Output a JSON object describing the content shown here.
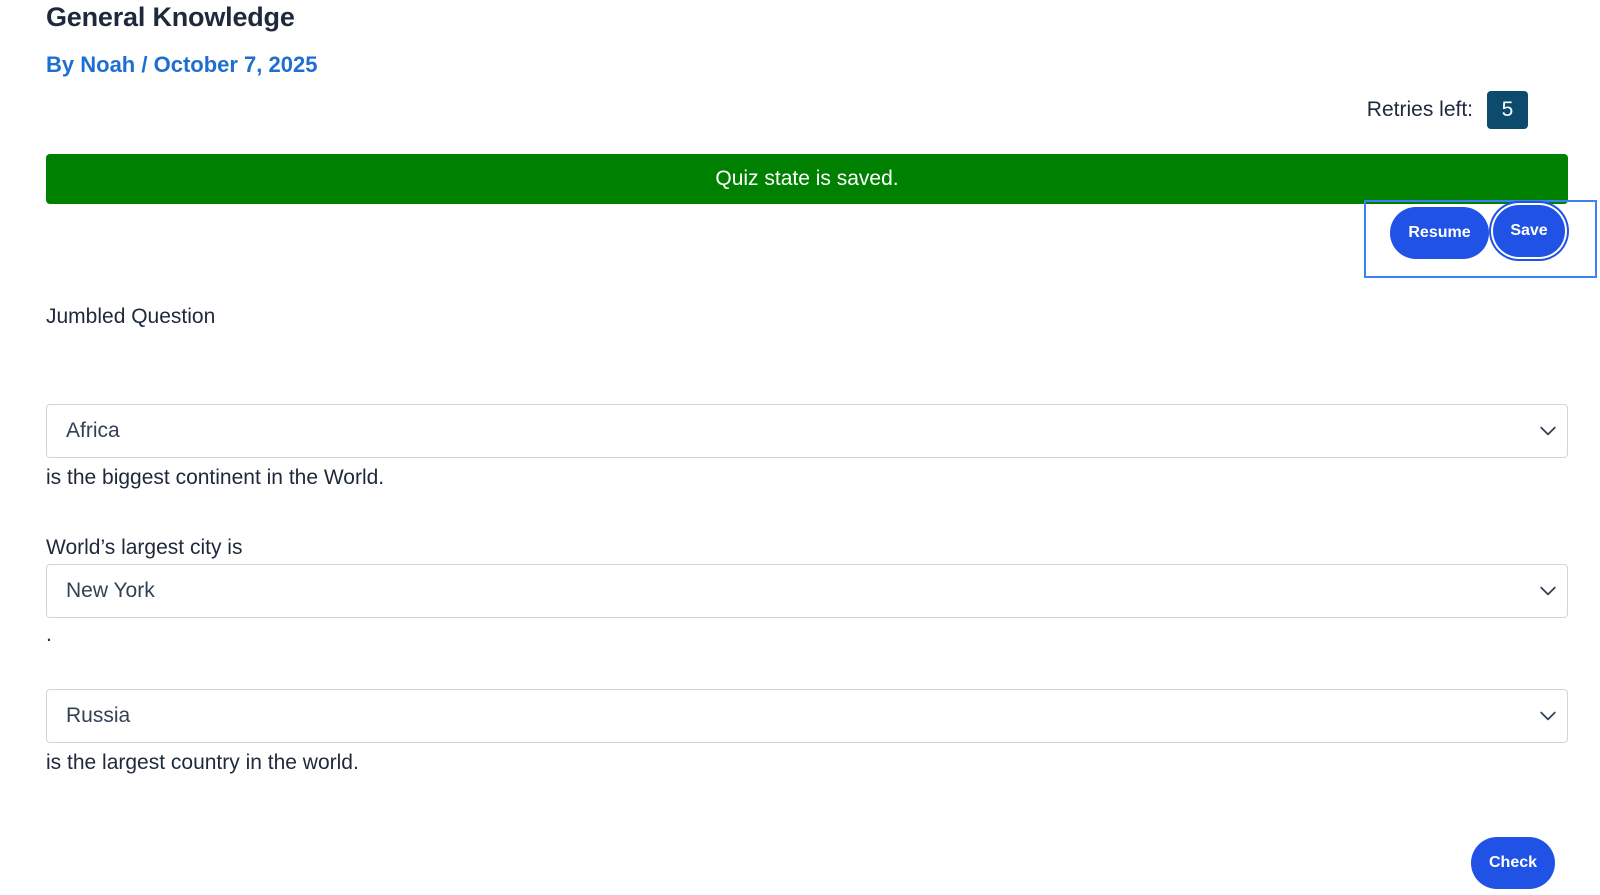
{
  "post": {
    "title": "General Knowledge",
    "byline_prefix": "By ",
    "author": "Noah",
    "separator": " / ",
    "date": "October 7, 2025"
  },
  "retries": {
    "label": "Retries left:",
    "count": "5"
  },
  "banner": {
    "message": "Quiz state is saved."
  },
  "actions": {
    "resume_label": "Resume",
    "save_label": "Save",
    "check_label": "Check"
  },
  "question": {
    "label": "Jumbled Question",
    "items": [
      {
        "prefix": "",
        "selected": "Africa",
        "suffix": "is the biggest continent in the World."
      },
      {
        "prefix": "World’s largest city is",
        "selected": "New York",
        "suffix": "."
      },
      {
        "prefix": "",
        "selected": "Russia",
        "suffix": "is the largest country in the world."
      }
    ]
  },
  "colors": {
    "banner": "#008000",
    "button": "#2052e6",
    "link": "#1e6fd0",
    "badge": "#0c4a6e"
  },
  "icons": {
    "dropdown": "chevron-down-icon"
  }
}
